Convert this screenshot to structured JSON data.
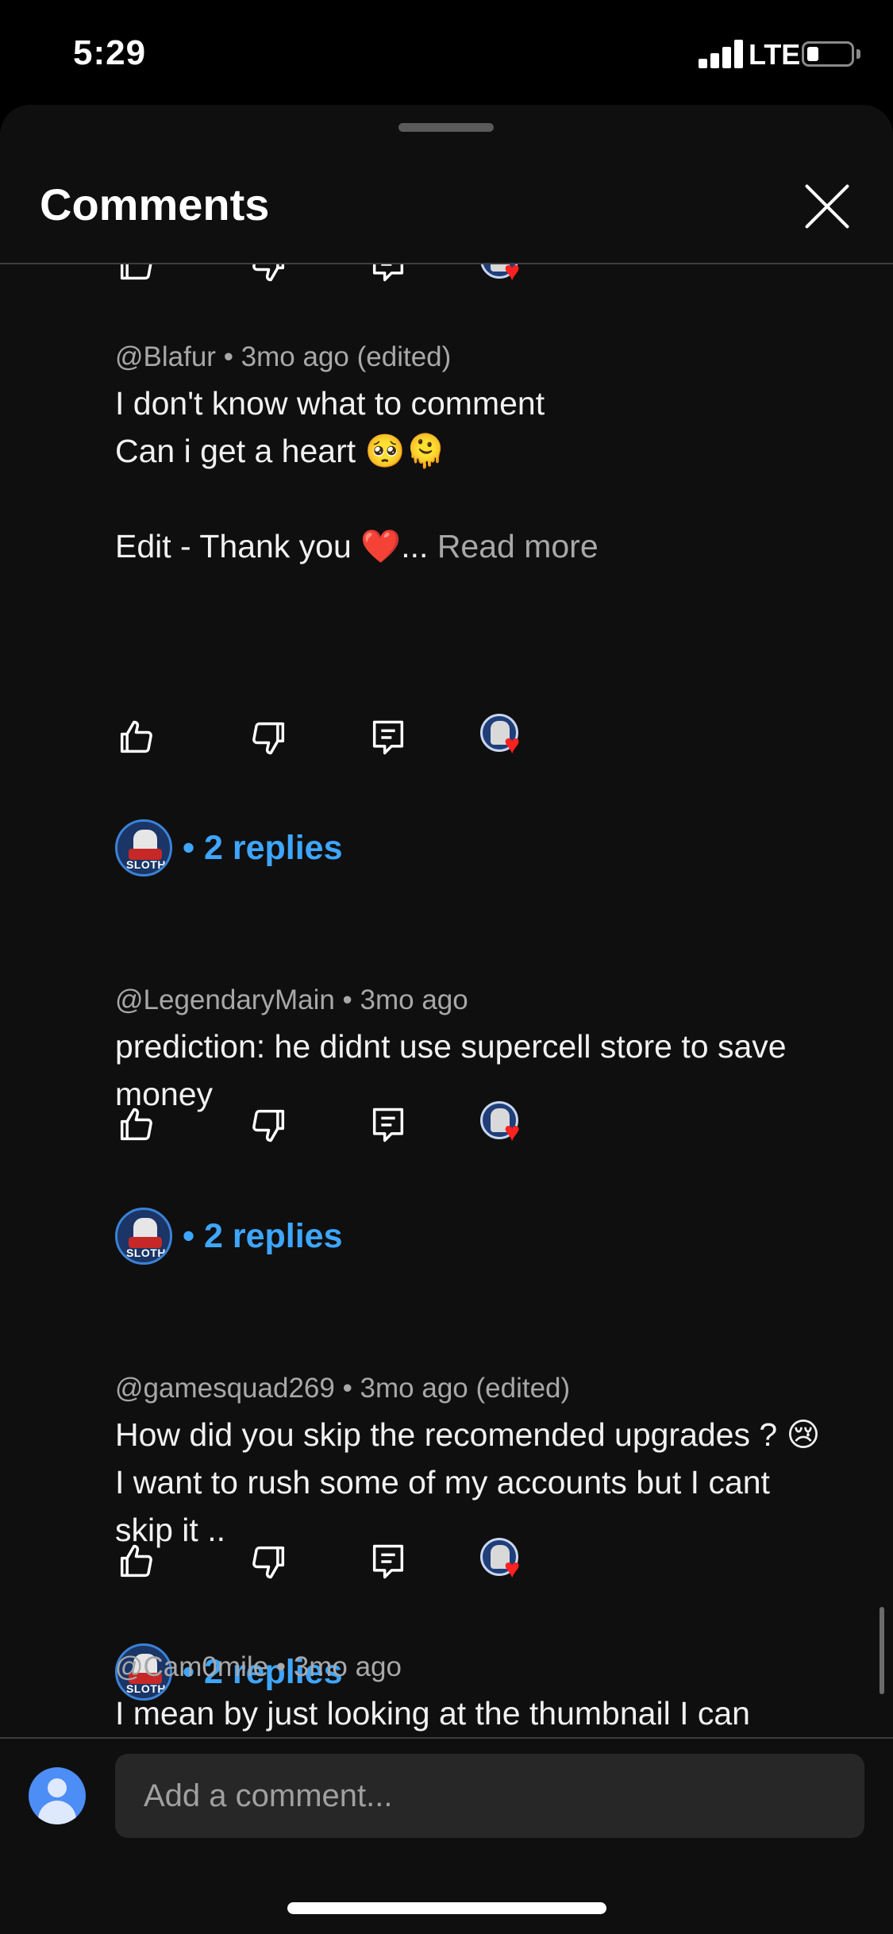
{
  "status_bar": {
    "time": "5:29",
    "network": "LTE"
  },
  "sheet": {
    "title": "Comments"
  },
  "icons": {
    "like": "thumbs-up-icon",
    "dislike": "thumbs-down-icon",
    "reply": "reply-icon",
    "close": "close-icon",
    "creator_heart": "heart-icon"
  },
  "creator_badge": {
    "label": "SLOTH"
  },
  "comments": [
    {
      "author": "@Blafur",
      "age": "3mo ago (edited)",
      "text": "I don't know what to comment\nCan i get a heart 🥺🫠\n\nEdit - Thank you ❤️...",
      "read_more": "Read more",
      "replies": "• 2 replies"
    },
    {
      "author": "@LegendaryMain",
      "age": "3mo ago",
      "text": "prediction: he didnt use supercell store to save money",
      "replies": "• 2 replies"
    },
    {
      "author": "@gamesquad269",
      "age": "3mo ago (edited)",
      "text": "How did you skip the recomended upgrades ? 😢 I want to rush some of my accounts but I cant skip it ..",
      "replies": "• 2 replies"
    },
    {
      "author": "@Cam0mile",
      "age": "3mo ago",
      "text": "I mean by just looking at the thumbnail I can"
    }
  ],
  "composer": {
    "placeholder": "Add a comment..."
  },
  "colors": {
    "accent_link": "#3ea6ff",
    "heart": "#ff2020",
    "sheet_bg": "#0f0f0f"
  }
}
